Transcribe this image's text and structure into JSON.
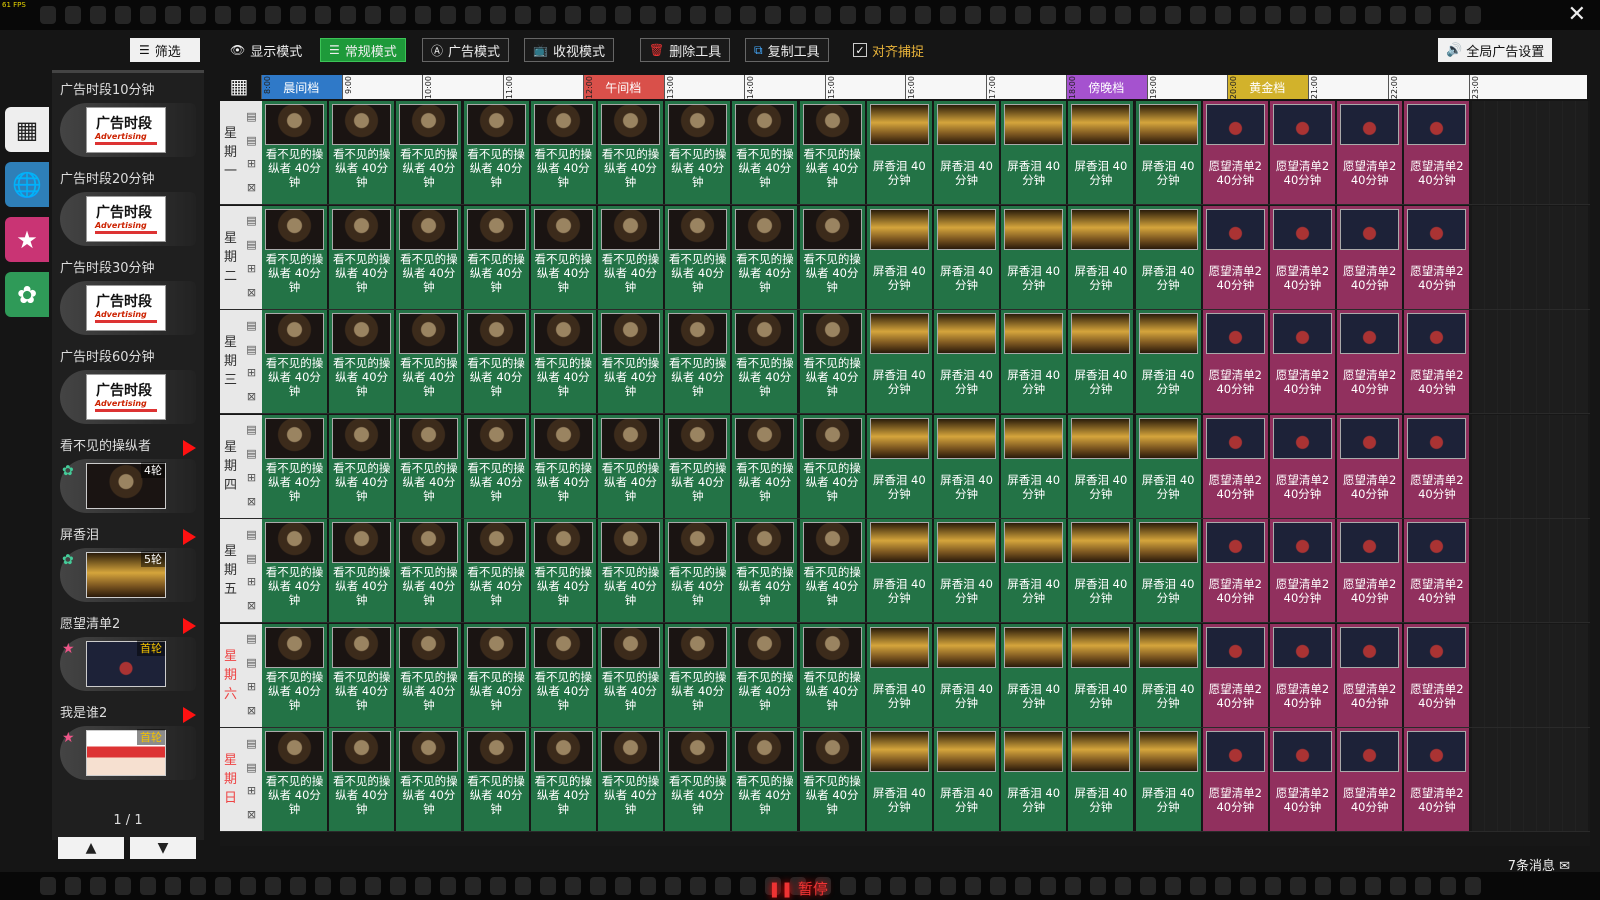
{
  "fps": "61 FPS",
  "toolbar": {
    "filter": "筛选",
    "display_mode": "显示模式",
    "normal_mode": "常规模式",
    "ad_mode": "广告模式",
    "rating_mode": "收视模式",
    "delete_tool": "删除工具",
    "copy_tool": "复制工具",
    "snap": "对齐捕捉",
    "global_ad": "全局广告设置"
  },
  "library": [
    {
      "title": "广告时段10分钟",
      "kind": "ad"
    },
    {
      "title": "广告时段20分钟",
      "kind": "ad"
    },
    {
      "title": "广告时段30分钟",
      "kind": "ad"
    },
    {
      "title": "广告时段60分钟",
      "kind": "ad"
    },
    {
      "title": "看不见的操纵者",
      "kind": "film",
      "badge": "4轮",
      "thumb": "th-a"
    },
    {
      "title": "屏香泪",
      "kind": "film",
      "badge": "5轮",
      "thumb": "th-b"
    },
    {
      "title": "愿望清单2",
      "kind": "premiere",
      "badge": "首轮",
      "thumb": "th-c"
    },
    {
      "title": "我是谁2",
      "kind": "premiere",
      "badge": "首轮",
      "thumb": "th-d"
    }
  ],
  "ad_thumb": {
    "cn": "广告时段",
    "en": "Advertising"
  },
  "pager": {
    "text": "1 / 1",
    "up": "▲",
    "down": "▼"
  },
  "timeline": {
    "segments": [
      {
        "label": "晨间档",
        "color": "#2f79c8"
      },
      {
        "label": "午间档",
        "color": "#d9504a"
      },
      {
        "label": "傍晚档",
        "color": "#a552cf"
      },
      {
        "label": "黄金档",
        "color": "#d2b22b"
      }
    ],
    "hours": [
      "8:00",
      "9:00",
      "10:00",
      "11:00",
      "12:00",
      "13:00",
      "14:00",
      "15:00",
      "16:00",
      "17:00",
      "18:00",
      "19:00",
      "20:00",
      "21:00",
      "22:00",
      "23:00"
    ]
  },
  "days": [
    {
      "chars": [
        "星",
        "期",
        "一"
      ],
      "weekend": false
    },
    {
      "chars": [
        "星",
        "期",
        "二"
      ],
      "weekend": false
    },
    {
      "chars": [
        "星",
        "期",
        "三"
      ],
      "weekend": false
    },
    {
      "chars": [
        "星",
        "期",
        "四"
      ],
      "weekend": false
    },
    {
      "chars": [
        "星",
        "期",
        "五"
      ],
      "weekend": false
    },
    {
      "chars": [
        "星",
        "期",
        "六"
      ],
      "weekend": true
    },
    {
      "chars": [
        "星",
        "期",
        "日"
      ],
      "weekend": true
    }
  ],
  "row_tools": [
    "▤",
    "▤",
    "⊞",
    "⊠"
  ],
  "programs": [
    {
      "name": "看不见的操纵者",
      "duration": "40分钟",
      "count": 9,
      "color": "g",
      "thumb": "th-a"
    },
    {
      "name": "屏香泪",
      "duration": "40分钟",
      "count": 5,
      "color": "g",
      "thumb": "th-b"
    },
    {
      "name": "愿望清单2",
      "duration": "40分钟",
      "count": 4,
      "color": "m",
      "thumb": "th-c"
    }
  ],
  "pause": "❚❚ 暂停",
  "messages": "7条消息 ✉",
  "close": "✕"
}
